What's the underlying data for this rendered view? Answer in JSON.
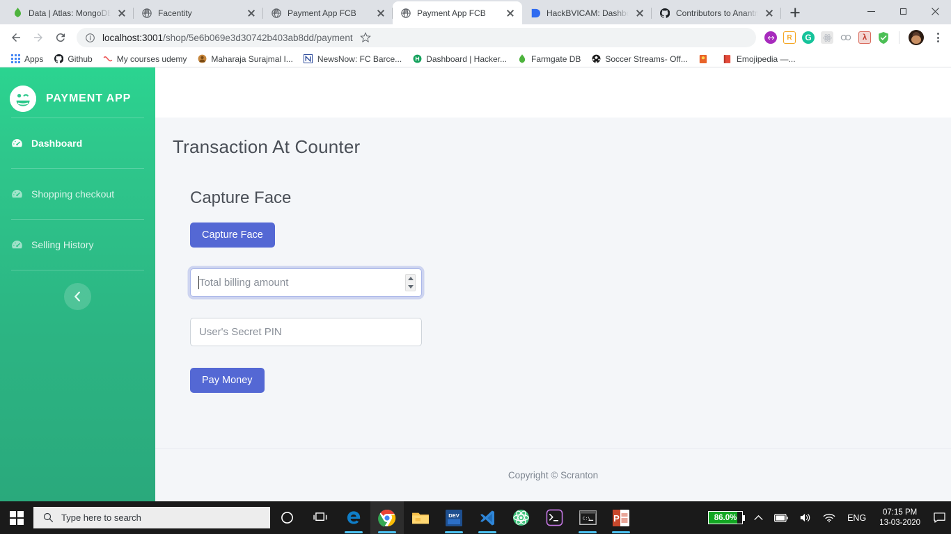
{
  "browser": {
    "tabs": [
      {
        "title": "Data | Atlas: MongoDB",
        "favicon": "mongodb-leaf-icon",
        "active": false
      },
      {
        "title": "Facentity",
        "favicon": "globe-icon",
        "active": false
      },
      {
        "title": "Payment App FCB",
        "favicon": "globe-icon",
        "active": false
      },
      {
        "title": "Payment App FCB",
        "favicon": "globe-icon",
        "active": true
      },
      {
        "title": "HackBVICAM: Dashboa",
        "favicon": "blue-square-icon",
        "active": false
      },
      {
        "title": "Contributors to Anantm",
        "favicon": "github-icon",
        "active": false
      }
    ],
    "new_tab_label": "New Tab",
    "window_controls": {
      "minimize": "minimize-icon",
      "maximize": "maximize-icon",
      "close": "close-icon"
    },
    "nav": {
      "back": "back-arrow-icon",
      "forward": "forward-arrow-icon",
      "reload": "reload-icon"
    },
    "omnibox": {
      "info_icon": "info-circle-icon",
      "url_host": "localhost:3001",
      "url_path": "/shop/5e6b069e3d30742b403ab8dd/payment",
      "full_url": "localhost:3001/shop/5e6b069e3d30742b403ab8dd/payment",
      "bookmark_icon": "star-icon"
    },
    "extensions": [
      {
        "name": "extension-purple-icon",
        "color": "#a72bbd"
      },
      {
        "name": "extension-react-devtools-icon",
        "color": "#f5a623"
      },
      {
        "name": "extension-grammarly-icon",
        "color": "#15c39a"
      },
      {
        "name": "extension-react-icon",
        "color": "#e6e6e6"
      },
      {
        "name": "extension-honey-icon",
        "color": "#cfd3d8"
      },
      {
        "name": "extension-adobe-acrobat-icon",
        "color": "#e5756a"
      },
      {
        "name": "extension-adblock-shield-icon",
        "color": "#4bbf55"
      }
    ],
    "profile": "avatar",
    "menu": "kebab-menu-icon",
    "bookmarks": [
      {
        "label": "Apps",
        "icon": "apps-grid-icon"
      },
      {
        "label": "Github",
        "icon": "github-icon"
      },
      {
        "label": "My courses udemy",
        "icon": "udemy-icon"
      },
      {
        "label": "Maharaja Surajmal I...",
        "icon": "college-icon"
      },
      {
        "label": "NewsNow: FC Barce...",
        "icon": "newsnow-icon"
      },
      {
        "label": "Dashboard | Hacker...",
        "icon": "hackerearth-icon"
      },
      {
        "label": "Farmgate DB",
        "icon": "mongodb-leaf-icon"
      },
      {
        "label": "Soccer Streams- Off...",
        "icon": "football-icon"
      },
      {
        "label": "",
        "icon": "orange-book-icon"
      },
      {
        "label": "Emojipedia —...",
        "icon": "emojipedia-icon"
      }
    ]
  },
  "app": {
    "sidebar": {
      "brand": "PAYMENT APP",
      "brand_logo": "winking-face-icon",
      "items": [
        {
          "label": "Dashboard",
          "icon": "dashboard-gauge-icon",
          "active": true
        },
        {
          "label": "Shopping checkout",
          "icon": "dashboard-gauge-icon",
          "active": false
        },
        {
          "label": "Selling History",
          "icon": "dashboard-gauge-icon",
          "active": false
        }
      ],
      "collapse_icon": "chevron-left-icon"
    },
    "page_title": "Transaction At Counter",
    "section_title": "Capture Face",
    "capture_button": "Capture Face",
    "amount_field": {
      "placeholder": "Total billing amount",
      "value": "",
      "focused": true,
      "spinner": "number-spinner-icon"
    },
    "pin_field": {
      "placeholder": "User's Secret PIN",
      "value": ""
    },
    "pay_button": "Pay Money",
    "footer": "Copyright © Scranton",
    "colors": {
      "brand_green": "#2ec88c",
      "button_blue": "#5468d4",
      "content_bg": "#f4f6f9"
    }
  },
  "taskbar": {
    "start": "windows-start-icon",
    "search_placeholder": "Type here to search",
    "search_icon": "search-icon",
    "cortana": "cortana-circle-icon",
    "task_view": "task-view-icon",
    "apps": [
      {
        "name": "microsoft-edge-icon",
        "running": true,
        "active": false
      },
      {
        "name": "google-chrome-icon",
        "running": true,
        "active": true
      },
      {
        "name": "file-explorer-icon",
        "running": false,
        "active": false
      },
      {
        "name": "visual-studio-icon",
        "running": true,
        "active": false
      },
      {
        "name": "vs-code-icon",
        "running": true,
        "active": false
      },
      {
        "name": "atom-editor-icon",
        "running": false,
        "active": false
      },
      {
        "name": "terminal-icon",
        "running": false,
        "active": false
      },
      {
        "name": "command-prompt-icon",
        "running": true,
        "active": false
      },
      {
        "name": "powerpoint-icon",
        "running": true,
        "active": false
      }
    ],
    "tray": {
      "battery_percent": "86.0%",
      "battery_fill": 86,
      "overflow": "show-hidden-icons-chevron",
      "battery_icon": "battery-icon",
      "volume_icon": "speaker-icon",
      "wifi_icon": "wifi-icon",
      "language": "ENG",
      "time": "07:15 PM",
      "date": "13-03-2020",
      "notifications": "action-center-icon"
    }
  }
}
